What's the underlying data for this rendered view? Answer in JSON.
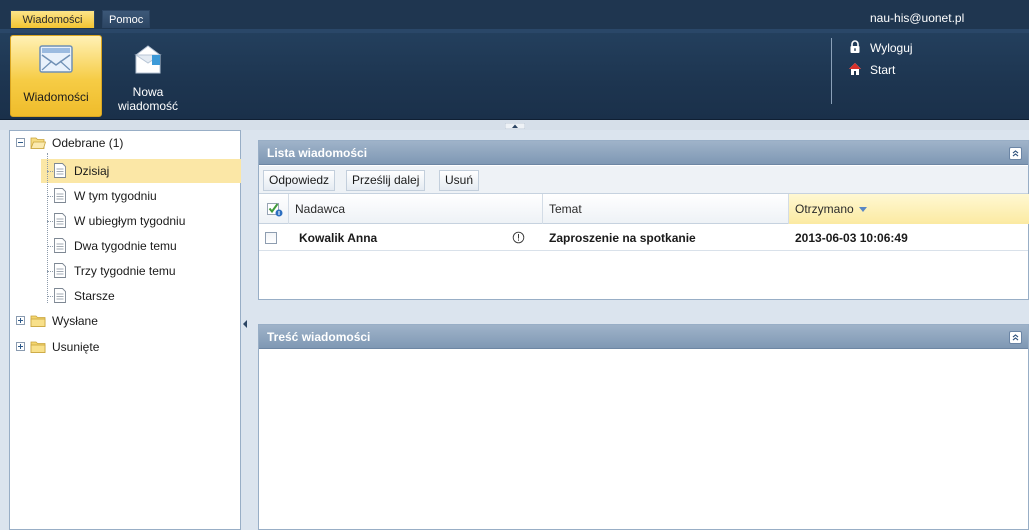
{
  "topbar": {
    "tabs": [
      {
        "label": "Wiadomości",
        "active": true
      },
      {
        "label": "Pomoc",
        "active": false
      }
    ],
    "user_email": "nau-his@uonet.pl"
  },
  "ribbon": {
    "buttons": [
      {
        "label": "Wiadomości",
        "icon": "envelope-icon",
        "active": true
      },
      {
        "label": "Nowa wiadomość",
        "icon": "new-message-icon",
        "active": false
      }
    ],
    "links": [
      {
        "label": "Wyloguj",
        "icon": "lock-icon"
      },
      {
        "label": "Start",
        "icon": "home-icon"
      }
    ]
  },
  "tree": {
    "folders": [
      {
        "label": "Odebrane (1)",
        "expanded": true,
        "children": [
          "Dzisiaj",
          "W tym tygodniu",
          "W ubiegłym tygodniu",
          "Dwa tygodnie temu",
          "Trzy tygodnie temu",
          "Starsze"
        ],
        "selected_child": "Dzisiaj"
      },
      {
        "label": "Wysłane",
        "expanded": false
      },
      {
        "label": "Usunięte",
        "expanded": false
      }
    ]
  },
  "list_panel": {
    "title": "Lista wiadomości",
    "toolbar": [
      "Odpowiedz",
      "Prześlij dalej",
      "Usuń"
    ],
    "columns": [
      "Nadawca",
      "Temat",
      "Otrzymano"
    ],
    "sorted_column": "Otrzymano",
    "rows": [
      {
        "sender": "Kowalik Anna",
        "subject": "Zaproszenie na spotkanie",
        "received": "2013-06-03 10:06:49",
        "unread": true
      }
    ]
  },
  "content_panel": {
    "title": "Treść wiadomości"
  },
  "colors": {
    "topbar_bg": "#1f3650",
    "active_tab": "#f4c431",
    "panel_header": "#8ca3bd",
    "selection": "#fbe7a6"
  }
}
